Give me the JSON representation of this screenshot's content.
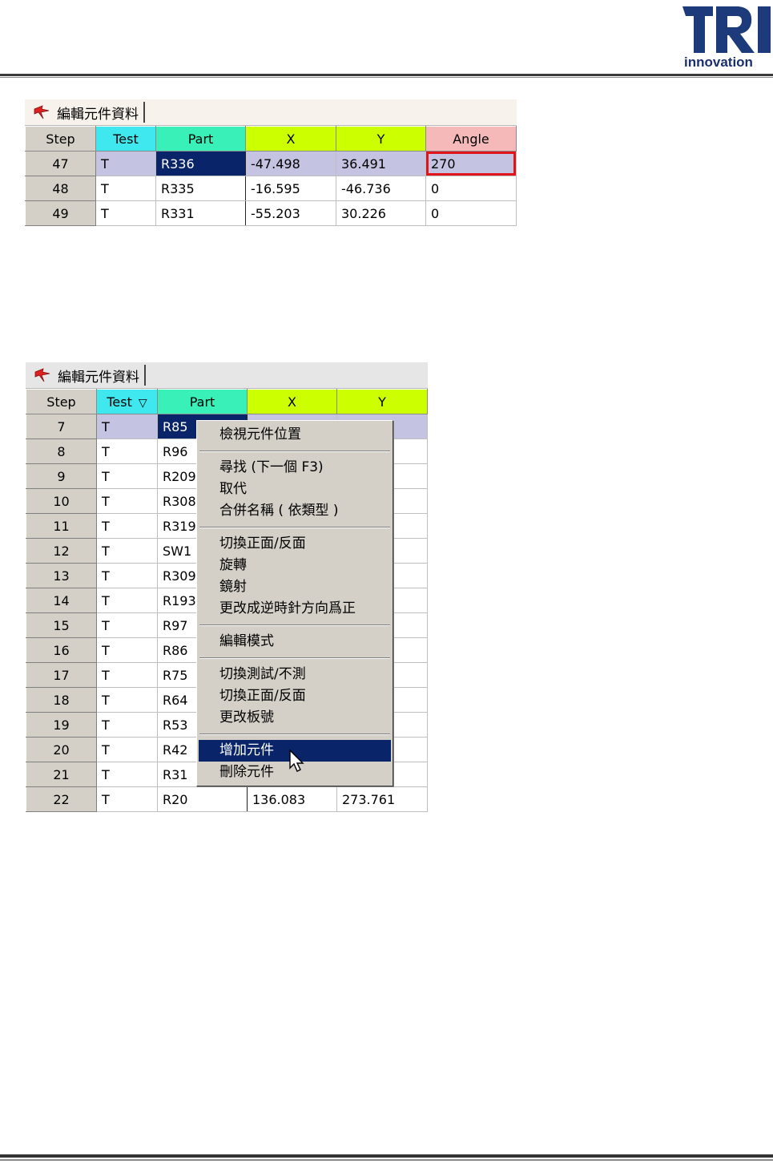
{
  "header": {
    "logo_text": "TRI",
    "logo_sub": "innovation"
  },
  "panel_top": {
    "tab_label": "編輯元件資料",
    "columns": [
      "Step",
      "Test",
      "Part",
      "X",
      "Y",
      "Angle"
    ],
    "rows": [
      {
        "step": "47",
        "test": "T",
        "part": "R336",
        "x": "-47.498",
        "y": "36.491",
        "angle": "270"
      },
      {
        "step": "48",
        "test": "T",
        "part": "R335",
        "x": "-16.595",
        "y": "-46.736",
        "angle": "0"
      },
      {
        "step": "49",
        "test": "T",
        "part": "R331",
        "x": "-55.203",
        "y": "30.226",
        "angle": "0"
      }
    ]
  },
  "panel_bottom": {
    "tab_label": "編輯元件資料",
    "columns": [
      "Step",
      "Test",
      "Part",
      "X",
      "Y"
    ],
    "filter_icon": "▽",
    "rows": [
      {
        "step": "7",
        "test": "T",
        "part": "R85",
        "x": "",
        "y": ""
      },
      {
        "step": "8",
        "test": "T",
        "part": "R96",
        "x": "",
        "y": ""
      },
      {
        "step": "9",
        "test": "T",
        "part": "R209",
        "x": "",
        "y": ""
      },
      {
        "step": "10",
        "test": "T",
        "part": "R308",
        "x": "",
        "y": ""
      },
      {
        "step": "11",
        "test": "T",
        "part": "R319",
        "x": "",
        "y": ""
      },
      {
        "step": "12",
        "test": "T",
        "part": "SW1",
        "x": "",
        "y": ""
      },
      {
        "step": "13",
        "test": "T",
        "part": "R309",
        "x": "",
        "y": ""
      },
      {
        "step": "14",
        "test": "T",
        "part": "R193",
        "x": "",
        "y": ""
      },
      {
        "step": "15",
        "test": "T",
        "part": "R97",
        "x": "",
        "y": ""
      },
      {
        "step": "16",
        "test": "T",
        "part": "R86",
        "x": "",
        "y": ""
      },
      {
        "step": "17",
        "test": "T",
        "part": "R75",
        "x": "",
        "y": ""
      },
      {
        "step": "18",
        "test": "T",
        "part": "R64",
        "x": "",
        "y": ""
      },
      {
        "step": "19",
        "test": "T",
        "part": "R53",
        "x": "",
        "y": ""
      },
      {
        "step": "20",
        "test": "T",
        "part": "R42",
        "x": "",
        "y": ""
      },
      {
        "step": "21",
        "test": "T",
        "part": "R31",
        "x": "",
        "y": ""
      },
      {
        "step": "22",
        "test": "T",
        "part": "R20",
        "x": "136.083",
        "y": "273.761"
      }
    ]
  },
  "context_menu": {
    "items": [
      "檢視元件位置",
      "尋找 (下一個 F3)",
      "取代",
      "合併名稱 ( 依類型 )",
      "切換正面/反面",
      "旋轉",
      "鏡射",
      "更改成逆時針方向爲正",
      "編輯模式",
      "切換測試/不測",
      "切換正面/反面",
      "更改板號",
      "增加元件",
      "刪除元件"
    ],
    "highlighted_index": 12
  },
  "colors": {
    "test_header": "#3fe8ef",
    "part_header": "#39f0b8",
    "xy_header": "#ccff00",
    "angle_header": "#f6b9b9",
    "selection": "#0a246a",
    "highlight_box": "#e0141c"
  }
}
